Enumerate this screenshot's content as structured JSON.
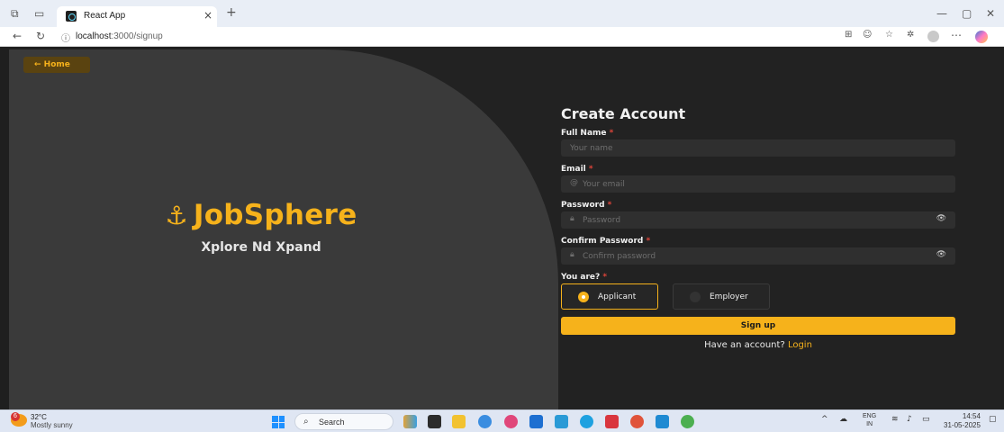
{
  "browser": {
    "tab_title": "React App",
    "tab_close": "×",
    "new_tab": "+",
    "url_host": "localhost",
    "url_path": ":3000/signup",
    "window_controls": [
      "—",
      "▢",
      "✕"
    ]
  },
  "hero": {
    "home_label": "← Home",
    "brand_icon": "anchor-icon",
    "brand_name": "JobSphere",
    "tagline": "Xplore Nd Xpand"
  },
  "form": {
    "title": "Create Account",
    "required_mark": "*",
    "full_name": {
      "label": "Full Name",
      "placeholder": "Your name"
    },
    "email": {
      "label": "Email",
      "placeholder": "Your email"
    },
    "password": {
      "label": "Password",
      "placeholder": "Password"
    },
    "confirm_password": {
      "label": "Confirm Password",
      "placeholder": "Confirm password"
    },
    "role_label": "You are?",
    "roles": [
      {
        "label": "Applicant",
        "selected": true
      },
      {
        "label": "Employer",
        "selected": false
      }
    ],
    "submit_label": "Sign up",
    "have_account_text": "Have an account?",
    "login_link": "Login"
  },
  "taskbar": {
    "weather_badge": "6",
    "weather_temp": "32°C",
    "weather_desc": "Mostly sunny",
    "search_label": "Search",
    "lang_line1": "ENG",
    "lang_line2": "IN",
    "time": "14:54",
    "date": "31-05-2025"
  },
  "colors": {
    "accent": "#f6b21b",
    "background": "#222222",
    "hero_panel": "#3a3a3a",
    "required": "#e0453a"
  }
}
